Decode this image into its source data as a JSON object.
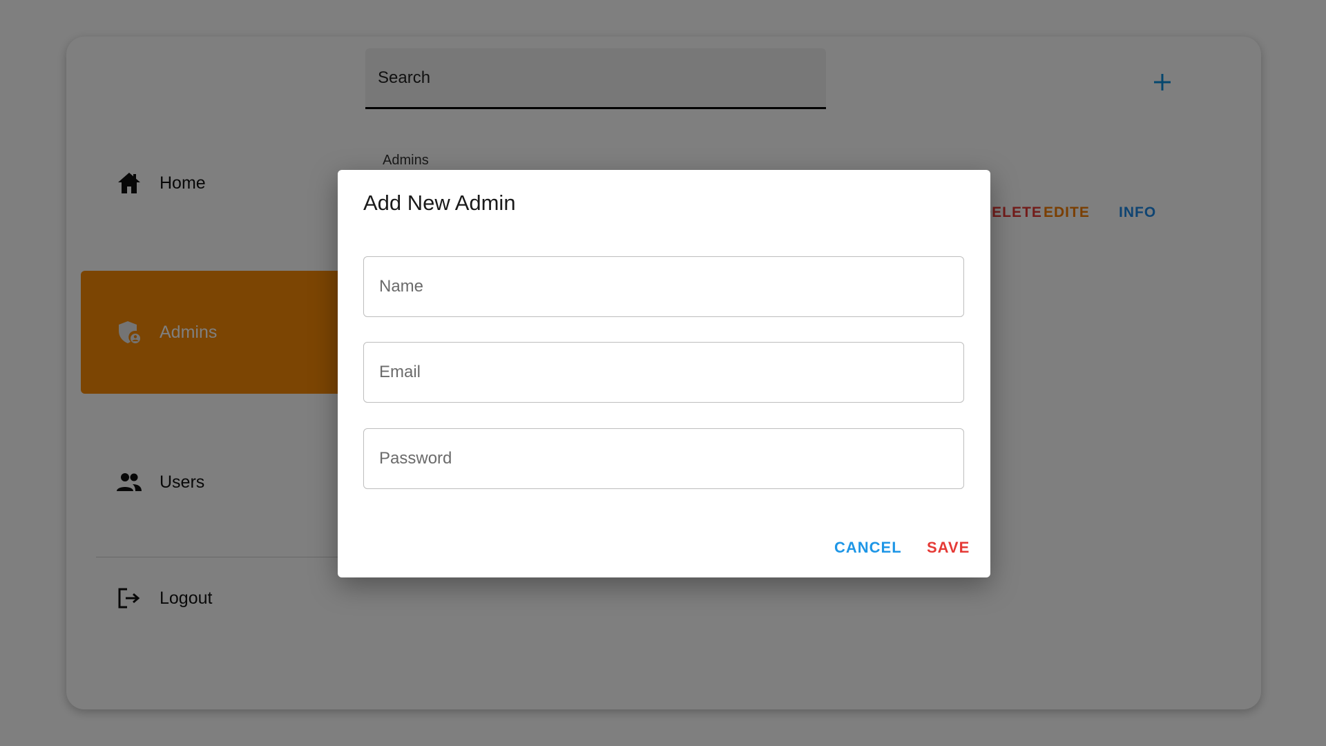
{
  "search": {
    "placeholder": "Search"
  },
  "header": {
    "breadcrumb": "Admins"
  },
  "row_actions": {
    "delete": "DELETE",
    "edit": "EDITE",
    "info": "INFO"
  },
  "sidebar": {
    "items": [
      {
        "label": "Home",
        "icon": "home-icon"
      },
      {
        "label": "Admins",
        "icon": "admin-shield-icon",
        "active": true
      },
      {
        "label": "Users",
        "icon": "users-icon"
      },
      {
        "label": "Logout",
        "icon": "logout-icon"
      }
    ]
  },
  "dialog": {
    "title": "Add New Admin",
    "fields": {
      "name_placeholder": "Name",
      "email_placeholder": "Email",
      "password_placeholder": "Password"
    },
    "cancel_label": "CANCEL",
    "save_label": "SAVE"
  },
  "colors": {
    "accent_orange": "#f98a06",
    "primary_blue": "#1e96e6",
    "danger_red": "#e53935",
    "backdrop": "rgba(0,0,0,0.5)"
  }
}
